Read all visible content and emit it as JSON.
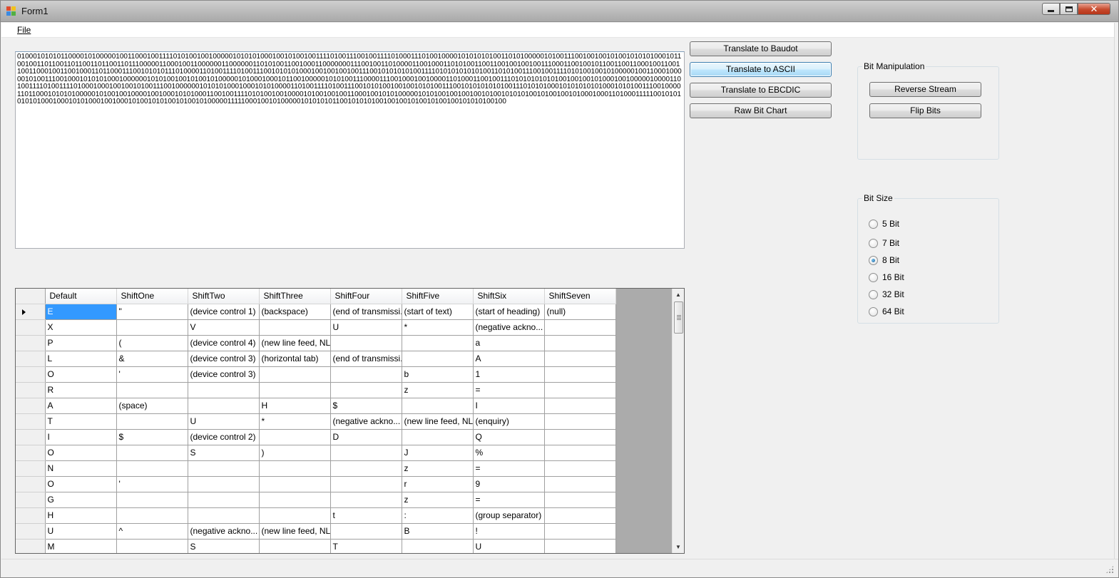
{
  "window": {
    "title": "Form1",
    "minimize_glyph": "",
    "close_glyph": "✕"
  },
  "menu": {
    "file_first": "F",
    "file_rest": "ile"
  },
  "bit_stream": "0100010101011000010100000100110001001111010100100100000101010100010010100100111101001110010011110100011101001000010101010100110101000001010011100100100101001010101000101100100110110011011001101100110111000001100010011000000110000001101010011001000110000000111001001101000011001000110101001100110010010010011100011001001011001100110001001100110011000100110010001101100011100101010111010000110100111101001110010101010001001001001001110010101010100111101010101010100110101001110010011110101001001010000010011000100000101001110010001010101000100000010101001001010010100000101000100010110010000010101001110000111001000100100001101000110010011101010101010100100100101000100100000100001101001111010011110100010001001001010011100100000010101010001000101010000110100111101001110010101001001001010100111001010101010100111010101000101010101010001010100111001000011011000101010100000101001001000010010001010100011001001111010100100100001010010010011000100101010000010101001001001001010010101010010100100101000100011010001111100101010101010001000101010001001000101001010100101001010000011111000100101000001010101011001010101001001001010010100100101010100100",
  "buttons": {
    "baudot": "Translate to Baudot",
    "ascii": "Translate to ASCII",
    "ebcdic": "Translate to EBCDIC",
    "raw": "Raw Bit Chart",
    "reverse": "Reverse Stream",
    "flip": "Flip Bits"
  },
  "bit_manipulation": {
    "title": "Bit Manipulation"
  },
  "bit_size": {
    "title": "Bit Size",
    "options": [
      "5 Bit",
      "7 Bit",
      "8 Bit",
      "16 Bit",
      "32 Bit",
      "64 Bit"
    ],
    "selected": "8 Bit"
  },
  "grid": {
    "columns": [
      "Default",
      "ShiftOne",
      "ShiftTwo",
      "ShiftThree",
      "ShiftFour",
      "ShiftFive",
      "ShiftSix",
      "ShiftSeven"
    ],
    "rows": [
      [
        "E",
        "\"",
        "(device control 1)",
        "(backspace)",
        "(end of transmissi...",
        "(start of text)",
        "(start of heading)",
        "(null)"
      ],
      [
        "X",
        "",
        "V",
        "",
        "U",
        "*",
        "(negative ackno...",
        ""
      ],
      [
        "P",
        "(",
        "(device control 4)",
        "(new line feed, NL)",
        "",
        "",
        "a",
        ""
      ],
      [
        "L",
        "&",
        "(device control 3)",
        "(horizontal tab)",
        "(end of transmissi...",
        "",
        "A",
        ""
      ],
      [
        "O",
        "'",
        "(device control 3)",
        "",
        "",
        "b",
        "1",
        ""
      ],
      [
        "R",
        "",
        "",
        "",
        "",
        "z",
        "=",
        ""
      ],
      [
        "A",
        "(space)",
        "",
        "H",
        "$",
        "",
        "I",
        ""
      ],
      [
        "T",
        "",
        "U",
        "*",
        "(negative ackno...",
        "(new line feed, NL)",
        "(enquiry)",
        ""
      ],
      [
        "I",
        "$",
        "(device control 2)",
        "",
        "D",
        "",
        "Q",
        ""
      ],
      [
        "O",
        "",
        "S",
        ")",
        "",
        "J",
        "%",
        ""
      ],
      [
        "N",
        "",
        "",
        "",
        "",
        "z",
        "=",
        ""
      ],
      [
        "O",
        "'",
        "",
        "",
        "",
        "r",
        "9",
        ""
      ],
      [
        "G",
        "",
        "",
        "",
        "",
        "z",
        "=",
        ""
      ],
      [
        "H",
        "",
        "",
        "",
        "t",
        ":",
        "(group separator)",
        ""
      ],
      [
        "U",
        "^",
        "(negative ackno...",
        "(new line feed, NL)",
        "",
        "B",
        "!",
        ""
      ],
      [
        "M",
        "",
        "S",
        "",
        "T",
        "",
        "U",
        ""
      ]
    ],
    "current_row": 0
  },
  "colors": {
    "selection": "#3399ff",
    "grid_background": "#ababab",
    "focused_button": "#bee6fd"
  }
}
